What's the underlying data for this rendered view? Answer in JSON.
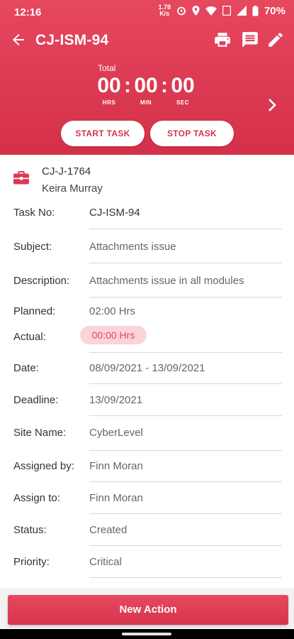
{
  "status_bar": {
    "time": "12:16",
    "net_speed": "1.78",
    "battery": "70%"
  },
  "app_bar": {
    "title": "CJ-ISM-94"
  },
  "timer": {
    "label": "Total",
    "hours": "00",
    "minutes": "00",
    "seconds": "00",
    "hours_unit": "HRS",
    "minutes_unit": "MIN",
    "seconds_unit": "SEC",
    "separator": ":"
  },
  "buttons": {
    "start": "START TASK",
    "stop": "STOP TASK",
    "new_action": "New Action"
  },
  "job": {
    "ref": "CJ-J-1764",
    "name": "Keira Murray"
  },
  "details": [
    {
      "label": "Task No:",
      "value": "CJ-ISM-94"
    },
    {
      "label": "Subject:",
      "value": "Attachments issue"
    },
    {
      "label": "Description:",
      "value": "Attachments issue in all modules"
    },
    {
      "label": "Planned:",
      "value": "02:00 Hrs"
    },
    {
      "label": "Actual:",
      "value": "00:00 Hrs"
    },
    {
      "label": "Date:",
      "value": "08/09/2021 - 13/09/2021"
    },
    {
      "label": "Deadline:",
      "value": "13/09/2021"
    },
    {
      "label": "Site Name:",
      "value": "CyberLevel"
    },
    {
      "label": "Assigned by:",
      "value": "Finn Moran"
    },
    {
      "label": "Assign to:",
      "value": "Finn Moran"
    },
    {
      "label": "Status:",
      "value": "Created"
    },
    {
      "label": "Priority:",
      "value": "Critical"
    }
  ],
  "icons": [
    "back-arrow-icon",
    "print-icon",
    "comment-icon",
    "edit-icon",
    "chevron-right-icon",
    "briefcase-icon"
  ],
  "colors": {
    "accent": "#dc3a52",
    "actual_pill_bg": "#fbd3d8",
    "actual_pill_text": "#e04a61"
  }
}
